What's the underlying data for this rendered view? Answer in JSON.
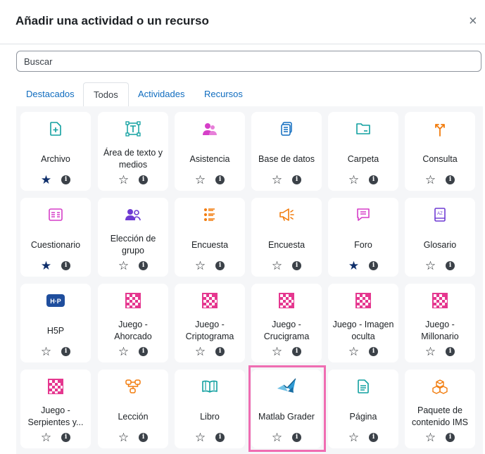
{
  "dialog": {
    "title": "Añadir una actividad o un recurso",
    "close_symbol": "×"
  },
  "search": {
    "placeholder": "Buscar",
    "value": ""
  },
  "tabs": [
    {
      "label": "Destacados",
      "active": false
    },
    {
      "label": "Todos",
      "active": true
    },
    {
      "label": "Actividades",
      "active": false
    },
    {
      "label": "Recursos",
      "active": false
    }
  ],
  "colors": {
    "blue": "#0f6cbf",
    "teal": "#11a0a0",
    "pink": "#d63fc8",
    "orange": "#f27c0d",
    "purple": "#6f3bd3",
    "highlight": "#ef6db2"
  },
  "items": [
    {
      "name": "Archivo",
      "icon": "file-icon",
      "starred": true
    },
    {
      "name": "Área de texto y medios",
      "icon": "text-area-icon",
      "starred": false
    },
    {
      "name": "Asistencia",
      "icon": "attendance-icon",
      "starred": false
    },
    {
      "name": "Base de datos",
      "icon": "database-icon",
      "starred": false
    },
    {
      "name": "Carpeta",
      "icon": "folder-icon",
      "starred": false
    },
    {
      "name": "Consulta",
      "icon": "choice-icon",
      "starred": false
    },
    {
      "name": "Cuestionario",
      "icon": "quiz-icon",
      "starred": true
    },
    {
      "name": "Elección de grupo",
      "icon": "group-choice-icon",
      "starred": false
    },
    {
      "name": "Encuesta",
      "icon": "survey-icon",
      "starred": false
    },
    {
      "name": "Encuesta",
      "icon": "feedback-icon",
      "starred": false
    },
    {
      "name": "Foro",
      "icon": "forum-icon",
      "starred": true
    },
    {
      "name": "Glosario",
      "icon": "glossary-icon",
      "starred": false
    },
    {
      "name": "H5P",
      "icon": "h5p-icon",
      "starred": false
    },
    {
      "name": "Juego - Ahorcado",
      "icon": "game-icon",
      "starred": false
    },
    {
      "name": "Juego - Criptograma",
      "icon": "game-icon",
      "starred": false
    },
    {
      "name": "Juego - Crucigrama",
      "icon": "game-icon",
      "starred": false
    },
    {
      "name": "Juego - Imagen oculta",
      "icon": "game-icon",
      "starred": false
    },
    {
      "name": "Juego - Millonario",
      "icon": "game-icon",
      "starred": false
    },
    {
      "name": "Juego - Serpientes y...",
      "icon": "game-icon",
      "starred": false
    },
    {
      "name": "Lección",
      "icon": "lesson-icon",
      "starred": false
    },
    {
      "name": "Libro",
      "icon": "book-icon",
      "starred": false
    },
    {
      "name": "Matlab Grader",
      "icon": "matlab-icon",
      "starred": false,
      "highlighted": true
    },
    {
      "name": "Página",
      "icon": "page-icon",
      "starred": false
    },
    {
      "name": "Paquete de contenido IMS",
      "icon": "ims-package-icon",
      "starred": false
    }
  ],
  "info_symbol": "i",
  "star_symbols": {
    "filled": "★",
    "empty": "☆"
  }
}
